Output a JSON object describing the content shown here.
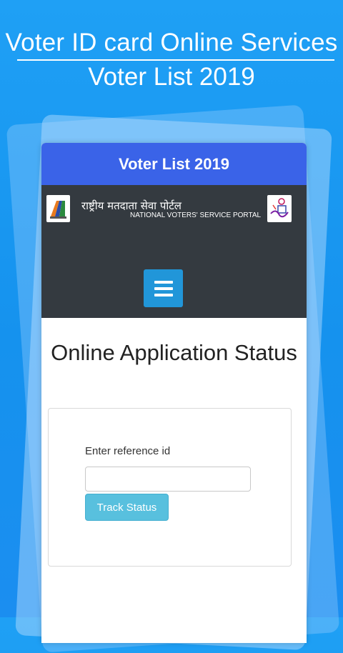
{
  "promo": {
    "title": "Voter ID card Online Services",
    "subtitle": "Voter List 2019"
  },
  "app_bar": {
    "title": "Voter List 2019"
  },
  "portal": {
    "hindi_name": "राष्ट्रीय मतदाता सेवा पोर्टल",
    "english_name": "NATIONAL VOTERS' SERVICE PORTAL",
    "left_logo": "eci-logo-icon",
    "right_logo": "svp-logo-icon",
    "menu_icon": "hamburger-menu-icon"
  },
  "main": {
    "heading": "Online Application Status",
    "form": {
      "label": "Enter reference id",
      "input_value": "",
      "button_label": "Track Status"
    }
  },
  "colors": {
    "background": "#1a98f2",
    "app_bar": "#3a63e8",
    "portal_header": "#343a40",
    "menu_button": "#2196d9",
    "track_button": "#58c0de"
  }
}
